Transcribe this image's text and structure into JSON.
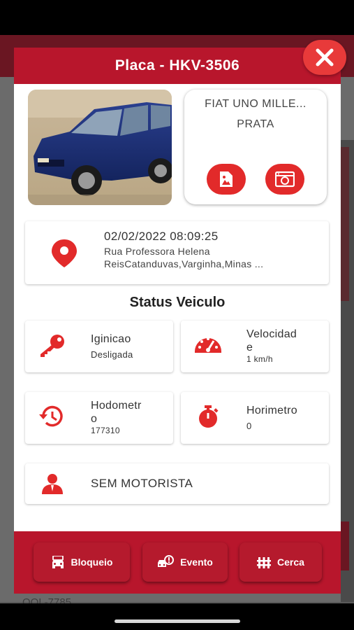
{
  "modal": {
    "title": "Placa - HKV-3506"
  },
  "vehicle": {
    "model": "FIAT UNO MILLE...",
    "color": "PRATA"
  },
  "location": {
    "datetime": "02/02/2022 08:09:25",
    "address_line1": "Rua Professora Helena",
    "address_line2": "ReisCatanduvas,Varginha,Minas ..."
  },
  "status": {
    "title": "Status Veiculo",
    "ignition": {
      "label": "Iginicao",
      "value": "Desligada"
    },
    "speed": {
      "label_line1": "Velocidad",
      "label_line2": "e",
      "value": "1 km/h"
    },
    "odometer": {
      "label_line1": "Hodometr",
      "label_line2": "o",
      "value": "177310"
    },
    "hourmeter": {
      "label": "Horimetro",
      "value": "0"
    }
  },
  "driver": {
    "label": "SEM MOTORISTA"
  },
  "footer": {
    "block_label": "Bloqueio",
    "event_label": "Evento",
    "fence_label": "Cerca"
  },
  "background": {
    "plate_text": "QQL-7785"
  },
  "colors": {
    "brand_red": "#b8162c",
    "icon_red": "#e22a2a",
    "close_red": "#e83a3a"
  },
  "icons": {
    "close": "close-icon",
    "photo": "image-icon",
    "camera": "camera-icon",
    "location": "location-pin-icon",
    "ignition": "key-icon",
    "speed": "speedometer-icon",
    "odometer": "history-icon",
    "hourmeter": "stopwatch-icon",
    "driver": "driver-icon",
    "block": "car-lock-icon",
    "event": "car-event-icon",
    "fence": "fence-icon"
  }
}
